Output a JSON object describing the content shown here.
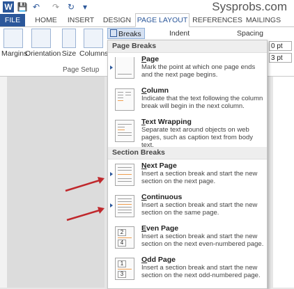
{
  "titlebar": {
    "watermark": "Sysprobs.com",
    "icons": [
      "word-icon",
      "save-icon",
      "undo-icon",
      "redo-icon",
      "refresh-icon",
      "customize-icon"
    ]
  },
  "tabs": [
    "FILE",
    "HOME",
    "INSERT",
    "DESIGN",
    "PAGE LAYOUT",
    "REFERENCES",
    "MAILINGS"
  ],
  "ribbon": {
    "margins": "Margins",
    "orientation": "Orientation",
    "size": "Size",
    "columns": "Columns",
    "breaks": "Breaks",
    "group_label": "Page Setup",
    "indent": "Indent",
    "spacing": "Spacing",
    "spacing_before": "0 pt",
    "spacing_after": "3 pt"
  },
  "menu": {
    "page_breaks_header": "Page Breaks",
    "section_breaks_header": "Section Breaks",
    "page_breaks": [
      {
        "title": "Page",
        "underline": "P",
        "rest": "age",
        "desc": "Mark the point at which one page ends and the next page begins."
      },
      {
        "title": "Column",
        "underline": "C",
        "rest": "olumn",
        "desc": "Indicate that the text following the column break will begin in the next column."
      },
      {
        "title": "Text Wrapping",
        "underline": "T",
        "rest": "ext Wrapping",
        "desc": "Separate text around objects on web pages, such as caption text from body text."
      }
    ],
    "section_breaks": [
      {
        "title": "Next Page",
        "underline": "N",
        "rest": "ext Page",
        "desc": "Insert a section break and start the new section on the next page."
      },
      {
        "title": "Continuous",
        "underline": "C",
        "rest": "ontinuous",
        "desc": "Insert a section break and start the new section on the same page."
      },
      {
        "title": "Even Page",
        "underline": "E",
        "rest": "ven Page",
        "desc": "Insert a section break and start the new section on the next even-numbered page."
      },
      {
        "title": "Odd Page",
        "underline": "O",
        "rest": "dd Page",
        "desc": "Insert a section break and start the new section on the next odd-numbered page."
      }
    ]
  },
  "colors": {
    "accent": "#2b579a",
    "arrow": "#c0282c",
    "orange": "#ef9d4d"
  }
}
